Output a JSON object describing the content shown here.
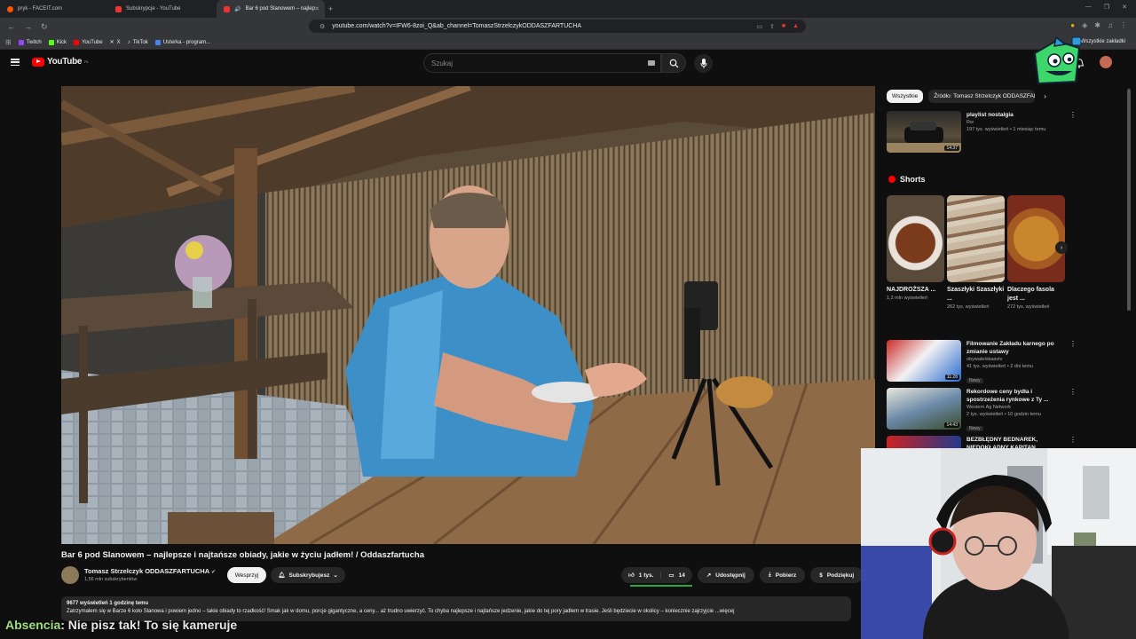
{
  "browser": {
    "tabs": [
      {
        "label": "pryk - FACEIT.com",
        "active": false
      },
      {
        "label": "Subskrypcje - YouTube",
        "active": false
      },
      {
        "label": "Bar 6 pod Slanowem – najlep",
        "active": true
      }
    ],
    "url": "youtube.com/watch?v=IFW6-8zoi_Q&ab_channel=TomaszStrzelczykODDASZFARTUCHA",
    "bookmarks": [
      "Twitch",
      "Kick",
      "YouTube",
      "X",
      "TikTok",
      "Usterka - program..."
    ],
    "all_bookmarks": "Wszystkie zakładki"
  },
  "youtube": {
    "logo": "YouTube",
    "logo_region": "PL",
    "search_placeholder": "Szukaj"
  },
  "video": {
    "title": "Bar 6 pod Slanowem – najlepsze i najtańsze obiady, jakie w życiu jadłem! / Oddaszfartucha",
    "channel": "Tomasz Strzelczyk ODDASZFARTUCHA",
    "subscribers": "1,56 mln subskrybentów",
    "support_label": "Wesprzyj",
    "subscribed_label": "Subskrybujesz",
    "likes": "1 tys.",
    "comments": "14",
    "share_label": "Udostępnij",
    "download_label": "Pobierz",
    "thanks_label": "Podziękuj",
    "stats": "9677 wyświetleń  1 godzinę temu",
    "description": "Zatrzymałem się w Barze 6 koło Slanowa i powiem jedno – takie obiady to rzadkość! Smak jak w domu, porcje gigantyczne, a ceny... aż trudno uwierzyć. To chyba najlepsze i najtańsze jedzenie, jakie do tej pory jadłem w trasie. Jeśli będziecie w okolicy – koniecznie zajrzyjcie ...więcej"
  },
  "sidebar": {
    "chips": [
      "Wszystkie",
      "Źródło: Tomasz Strzelczyk ODDASZFARTUCHA"
    ],
    "top_rec": {
      "title": "playlist nostalgia",
      "channel": "Rw",
      "meta": "197 tys. wyświetleń • 1 miesiąc temu",
      "duration": "14:37"
    },
    "shorts_label": "Shorts",
    "shorts": [
      {
        "title": "NAJDROŻSZA ...",
        "views": "1,2 mln wyświetleń"
      },
      {
        "title": "Szaszłyki Szaszłyki ...",
        "views": "262 tys. wyświetleń"
      },
      {
        "title": "Dlaczego fasola jest ...",
        "views": "272 tys. wyświetleń"
      }
    ],
    "recs": [
      {
        "title": "Filmowanie Zakładu karnego po zmianie ustawy",
        "channel": "obywatelskaavtv",
        "meta": "41 tys. wyświetleń • 2 dni temu",
        "badge": "Nowy",
        "duration": "11:28"
      },
      {
        "title": "Rekordowe ceny bydła i spostrzeżenia rynkowe z Ty ...",
        "channel": "Western Ag Network",
        "meta": "2 tys. wyświetleń • 10 godzin temu",
        "badge": "Nowy",
        "duration": "14:43"
      },
      {
        "title": "BEZBŁĘDNY BEDNAREK, NIEDOKŁADNY KAPITAN ...",
        "channel": "",
        "meta": "",
        "badge": "",
        "duration": ""
      }
    ]
  },
  "overlay_chat": {
    "user": "Absencia",
    "message": ": Nie pisz tak! To się kameruje"
  }
}
